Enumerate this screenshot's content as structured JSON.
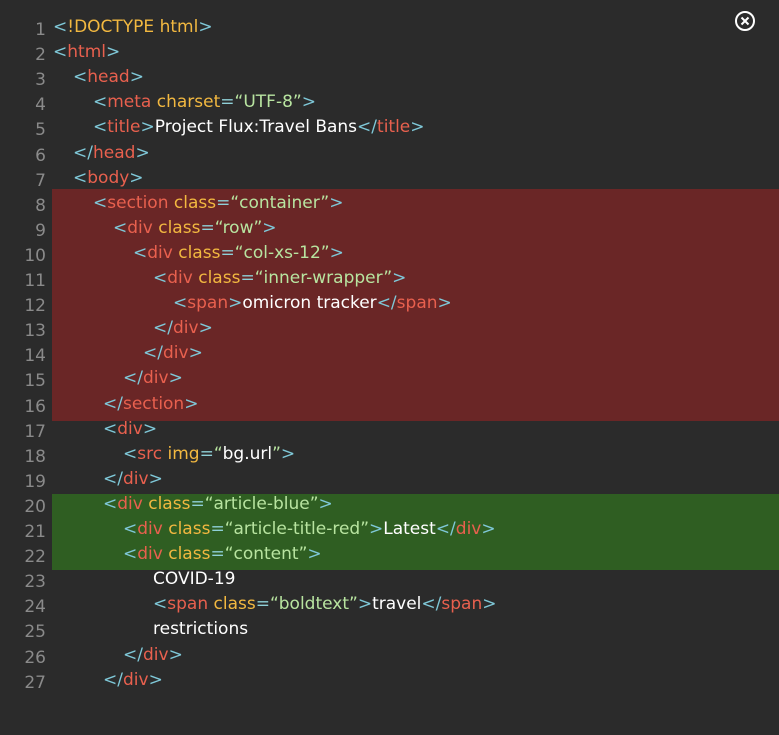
{
  "window": {
    "close_icon": "close-circle-icon"
  },
  "colors": {
    "background": "#2b2b2b",
    "highlight_red": "#6a2626",
    "highlight_green": "#2f5e22",
    "bracket": "#7fc8d8",
    "tag": "#e8604e",
    "attribute": "#f2b840",
    "string": "#b8e4a0",
    "text": "#ffffff",
    "line_number": "#8a8a8a"
  },
  "lines": [
    {
      "n": "1",
      "indent": 0,
      "tokens": [
        [
          "br",
          "<"
        ],
        [
          "doc",
          "!DOCTYPE"
        ],
        [
          "text",
          " "
        ],
        [
          "attr",
          "html"
        ],
        [
          "br",
          ">"
        ]
      ]
    },
    {
      "n": "2",
      "indent": 0,
      "tokens": [
        [
          "br",
          "<"
        ],
        [
          "tag",
          "html"
        ],
        [
          "br",
          ">"
        ]
      ]
    },
    {
      "n": "3",
      "indent": 2,
      "tokens": [
        [
          "br",
          "<"
        ],
        [
          "tag",
          "head"
        ],
        [
          "br",
          ">"
        ]
      ]
    },
    {
      "n": "4",
      "indent": 4,
      "tokens": [
        [
          "br",
          "<"
        ],
        [
          "tag",
          "meta"
        ],
        [
          "text",
          " "
        ],
        [
          "attr",
          "charset"
        ],
        [
          "eq",
          "="
        ],
        [
          "str",
          "“UTF-8”"
        ],
        [
          "br",
          ">"
        ]
      ]
    },
    {
      "n": "5",
      "indent": 4,
      "tokens": [
        [
          "br",
          "<"
        ],
        [
          "tag",
          "title"
        ],
        [
          "br",
          ">"
        ],
        [
          "text",
          "Project Flux:Travel Bans"
        ],
        [
          "br",
          "</"
        ],
        [
          "tag",
          "title"
        ],
        [
          "br",
          ">"
        ]
      ]
    },
    {
      "n": "6",
      "indent": 2,
      "tokens": [
        [
          "br",
          "</"
        ],
        [
          "tag",
          "head"
        ],
        [
          "br",
          ">"
        ]
      ]
    },
    {
      "n": "7",
      "indent": 2,
      "tokens": [
        [
          "br",
          "<"
        ],
        [
          "tag",
          "body"
        ],
        [
          "br",
          ">"
        ]
      ]
    },
    {
      "n": "8",
      "indent": 4,
      "tokens": [
        [
          "br",
          "<"
        ],
        [
          "tag",
          "section"
        ],
        [
          "text",
          " "
        ],
        [
          "attr",
          "class"
        ],
        [
          "eq",
          "="
        ],
        [
          "str",
          "“container”"
        ],
        [
          "br",
          ">"
        ]
      ]
    },
    {
      "n": "9",
      "indent": 6,
      "tokens": [
        [
          "br",
          "<"
        ],
        [
          "tag",
          "div"
        ],
        [
          "text",
          " "
        ],
        [
          "attr",
          "class"
        ],
        [
          "eq",
          "="
        ],
        [
          "str",
          "“row”"
        ],
        [
          "br",
          ">"
        ]
      ]
    },
    {
      "n": "10",
      "indent": 8,
      "tokens": [
        [
          "br",
          "<"
        ],
        [
          "tag",
          "div"
        ],
        [
          "text",
          " "
        ],
        [
          "attr",
          "class"
        ],
        [
          "eq",
          "="
        ],
        [
          "str",
          "“col-xs-12”"
        ],
        [
          "br",
          ">"
        ]
      ]
    },
    {
      "n": "11",
      "indent": 10,
      "tokens": [
        [
          "br",
          "<"
        ],
        [
          "tag",
          "div"
        ],
        [
          "text",
          " "
        ],
        [
          "attr",
          "class"
        ],
        [
          "eq",
          "="
        ],
        [
          "str",
          "“inner-wrapper”"
        ],
        [
          "br",
          ">"
        ]
      ]
    },
    {
      "n": "12",
      "indent": 12,
      "tokens": [
        [
          "br",
          "<"
        ],
        [
          "tag",
          "span"
        ],
        [
          "br",
          ">"
        ],
        [
          "text",
          "omicron tracker"
        ],
        [
          "br",
          "</"
        ],
        [
          "tag",
          "span"
        ],
        [
          "br",
          ">"
        ]
      ]
    },
    {
      "n": "13",
      "indent": 10,
      "tokens": [
        [
          "br",
          "</"
        ],
        [
          "tag",
          "div"
        ],
        [
          "br",
          ">"
        ]
      ]
    },
    {
      "n": "14",
      "indent": 9,
      "tokens": [
        [
          "br",
          "</"
        ],
        [
          "tag",
          "div"
        ],
        [
          "br",
          ">"
        ]
      ]
    },
    {
      "n": "15",
      "indent": 7,
      "tokens": [
        [
          "br",
          "</"
        ],
        [
          "tag",
          "div"
        ],
        [
          "br",
          ">"
        ]
      ]
    },
    {
      "n": "16",
      "indent": 5,
      "tokens": [
        [
          "br",
          "</"
        ],
        [
          "tag",
          "section"
        ],
        [
          "br",
          ">"
        ]
      ]
    },
    {
      "n": "17",
      "indent": 5,
      "tokens": [
        [
          "br",
          "<"
        ],
        [
          "tag",
          "div"
        ],
        [
          "br",
          ">"
        ]
      ]
    },
    {
      "n": "18",
      "indent": 7,
      "tokens": [
        [
          "br",
          "<"
        ],
        [
          "tag",
          "src"
        ],
        [
          "text",
          " "
        ],
        [
          "attr",
          "img"
        ],
        [
          "eq",
          "="
        ],
        [
          "str",
          "“"
        ],
        [
          "text",
          "bg.url"
        ],
        [
          "str",
          "”"
        ],
        [
          "br",
          ">"
        ]
      ]
    },
    {
      "n": "19",
      "indent": 5,
      "tokens": [
        [
          "br",
          "</"
        ],
        [
          "tag",
          "div"
        ],
        [
          "br",
          ">"
        ]
      ]
    },
    {
      "n": "20",
      "indent": 5,
      "tokens": [
        [
          "br",
          "<"
        ],
        [
          "tag",
          "div"
        ],
        [
          "text",
          " "
        ],
        [
          "attr",
          "class"
        ],
        [
          "eq",
          "="
        ],
        [
          "str",
          "“article-blue”"
        ],
        [
          "br",
          ">"
        ]
      ]
    },
    {
      "n": "21",
      "indent": 7,
      "tokens": [
        [
          "br",
          "<"
        ],
        [
          "tag",
          "div"
        ],
        [
          "text",
          " "
        ],
        [
          "attr",
          "class"
        ],
        [
          "eq",
          "="
        ],
        [
          "str",
          "“article-title-red”"
        ],
        [
          "br",
          ">"
        ],
        [
          "text",
          "Latest"
        ],
        [
          "br",
          "</"
        ],
        [
          "tag",
          "div"
        ],
        [
          "br",
          ">"
        ]
      ]
    },
    {
      "n": "22",
      "indent": 7,
      "tokens": [
        [
          "br",
          "<"
        ],
        [
          "tag",
          "div"
        ],
        [
          "text",
          " "
        ],
        [
          "attr",
          "class"
        ],
        [
          "eq",
          "="
        ],
        [
          "str",
          "“content”"
        ],
        [
          "br",
          ">"
        ]
      ]
    },
    {
      "n": "23",
      "indent": 10,
      "tokens": [
        [
          "text",
          "COVID-19"
        ]
      ]
    },
    {
      "n": "24",
      "indent": 10,
      "tokens": [
        [
          "br",
          "<"
        ],
        [
          "tag",
          "span"
        ],
        [
          "text",
          " "
        ],
        [
          "attr",
          "class"
        ],
        [
          "eq",
          "="
        ],
        [
          "str",
          "“boldtext”"
        ],
        [
          "br",
          ">"
        ],
        [
          "text",
          "travel"
        ],
        [
          "br",
          "</"
        ],
        [
          "tag",
          "span"
        ],
        [
          "br",
          ">"
        ]
      ]
    },
    {
      "n": "25",
      "indent": 10,
      "tokens": [
        [
          "text",
          "restrictions"
        ]
      ]
    },
    {
      "n": "26",
      "indent": 7,
      "tokens": [
        [
          "br",
          "</"
        ],
        [
          "tag",
          "div"
        ],
        [
          "br",
          ">"
        ]
      ]
    },
    {
      "n": "27",
      "indent": 5,
      "tokens": [
        [
          "br",
          "</"
        ],
        [
          "tag",
          "div"
        ],
        [
          "br",
          ">"
        ]
      ]
    }
  ]
}
